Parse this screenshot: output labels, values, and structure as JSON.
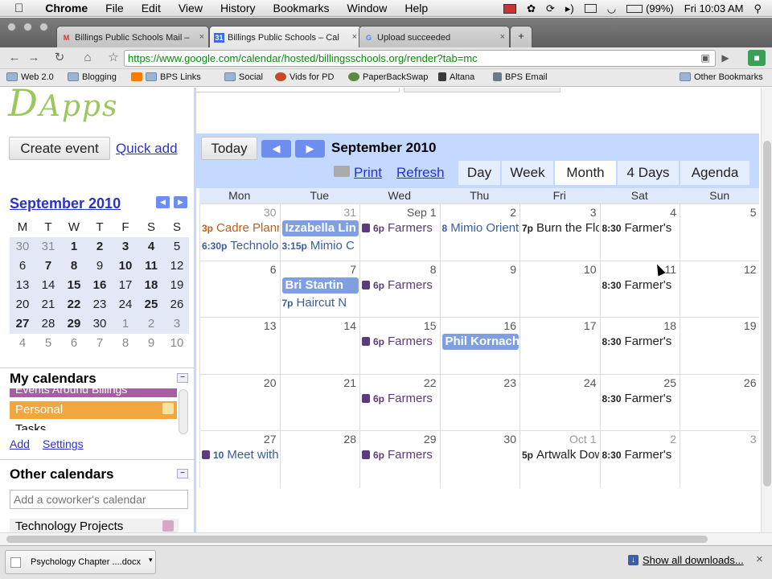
{
  "menubar": {
    "app_name": "Chrome",
    "menus": [
      "File",
      "Edit",
      "View",
      "History",
      "Bookmarks",
      "Window",
      "Help"
    ],
    "battery": "(99%)",
    "clock": "Fri 10:03 AM"
  },
  "tabs": [
    {
      "title": "Billings Public Schools Mail –",
      "icon": "gmail-icon",
      "color": "#d93025"
    },
    {
      "title": "Billings Public Schools – Cal",
      "icon": "calendar-31-icon",
      "color": "#3b6fd6",
      "fav_text": "31"
    },
    {
      "title": "Upload succeeded",
      "icon": "google-g-icon",
      "color": "#4a8af4"
    }
  ],
  "omnibox": {
    "url": "https://www.google.com/calendar/hosted/billingsschools.org/render?tab=mc"
  },
  "bookmarks": [
    {
      "label": "Web 2.0",
      "icon": "folder-icon"
    },
    {
      "label": "Blogging",
      "icon": "folder-icon"
    },
    {
      "label": "BPS Links",
      "icon": "blogger-icon"
    },
    {
      "label": "Social",
      "icon": "folder-icon"
    },
    {
      "label": "Vids for PD",
      "icon": "vids-icon"
    },
    {
      "label": "PaperBackSwap",
      "icon": "swap-icon"
    },
    {
      "label": "Altana",
      "icon": "altana-icon"
    },
    {
      "label": "BPS Email",
      "icon": "email-icon"
    },
    {
      "label": "Other Bookmarks",
      "icon": "folder-icon"
    }
  ],
  "sidebar": {
    "create_event": "Create event",
    "quick_add": "Quick add",
    "mini_title": "September 2010",
    "weekdays": [
      "M",
      "T",
      "W",
      "T",
      "F",
      "S",
      "S"
    ],
    "weeks": [
      [
        "30",
        "31",
        "1",
        "2",
        "3",
        "4",
        "5"
      ],
      [
        "6",
        "7",
        "8",
        "9",
        "10",
        "11",
        "12"
      ],
      [
        "13",
        "14",
        "15",
        "16",
        "17",
        "18",
        "19"
      ],
      [
        "20",
        "21",
        "22",
        "23",
        "24",
        "25",
        "26"
      ],
      [
        "27",
        "28",
        "29",
        "30",
        "1",
        "2",
        "3"
      ],
      [
        "4",
        "5",
        "6",
        "7",
        "8",
        "9",
        "10"
      ]
    ],
    "my_calendars_title": "My calendars",
    "my_calendars": [
      {
        "label": "Events Around Billings",
        "color": "#a65fa3"
      },
      {
        "label": "Personal",
        "color": "#f2a640"
      },
      {
        "label": "Tasks",
        "color": "#ffffff"
      }
    ],
    "add_link": "Add",
    "settings_link": "Settings",
    "other_calendars_title": "Other calendars",
    "coworker_placeholder": "Add a coworker's calendar",
    "other_calendars": [
      {
        "label": "Technology Projects",
        "color": "#f0f0f0"
      }
    ]
  },
  "main": {
    "today_btn": "Today",
    "month_title": "September 2010",
    "print_link": "Print",
    "refresh_link": "Refresh",
    "views": [
      "Day",
      "Week",
      "Month",
      "4 Days",
      "Agenda"
    ],
    "selected_view": "Month",
    "weekday_headers": [
      "Mon",
      "Tue",
      "Wed",
      "Thu",
      "Fri",
      "Sat",
      "Sun"
    ],
    "weeks": [
      [
        "30",
        "31",
        "Sep 1",
        "2",
        "3",
        "4",
        "5"
      ],
      [
        "6",
        "7",
        "8",
        "9",
        "10",
        "11",
        "12"
      ],
      [
        "13",
        "14",
        "15",
        "16",
        "17",
        "18",
        "19"
      ],
      [
        "20",
        "21",
        "22",
        "23",
        "24",
        "25",
        "26"
      ],
      [
        "27",
        "28",
        "29",
        "30",
        "Oct 1",
        "2",
        "3"
      ]
    ]
  },
  "events": [
    {
      "week": 0,
      "day": 0,
      "row": 0,
      "time": "3p",
      "title": "Cadre Planning",
      "color": "#c25d1a"
    },
    {
      "week": 0,
      "day": 0,
      "row": 1,
      "time": "6:30p",
      "title": "Technology",
      "color": "#3a5d9c"
    },
    {
      "week": 0,
      "day": 1,
      "row": 0,
      "chip": true,
      "title": "Izzabella Lin",
      "color": "#7f9fe0"
    },
    {
      "week": 0,
      "day": 1,
      "row": 1,
      "time": "3:15p",
      "title": "Mimio C",
      "color": "#3a5d9c"
    },
    {
      "week": 0,
      "day": 2,
      "row": 0,
      "recur": true,
      "time": "6p",
      "title": "Farmers",
      "color": "#5c3a7c"
    },
    {
      "week": 0,
      "day": 3,
      "row": 0,
      "time": "8",
      "title": "Mimio Orientation",
      "color": "#3a5d9c"
    },
    {
      "week": 0,
      "day": 4,
      "row": 0,
      "time": "7p",
      "title": "Burn the Floor",
      "color": "#222222"
    },
    {
      "week": 0,
      "day": 5,
      "row": 0,
      "time": "8:30",
      "title": "Farmer's",
      "color": "#222222"
    },
    {
      "week": 1,
      "day": 1,
      "row": 0,
      "chip": true,
      "title": "Bri Startin",
      "color": "#7f9fe0"
    },
    {
      "week": 1,
      "day": 1,
      "row": 1,
      "time": "7p",
      "title": "Haircut N",
      "color": "#3a5d9c"
    },
    {
      "week": 1,
      "day": 2,
      "row": 0,
      "recur": true,
      "time": "6p",
      "title": "Farmers",
      "color": "#5c3a7c"
    },
    {
      "week": 1,
      "day": 5,
      "row": 0,
      "time": "8:30",
      "title": "Farmer's",
      "color": "#222222"
    },
    {
      "week": 2,
      "day": 2,
      "row": 0,
      "recur": true,
      "time": "6p",
      "title": "Farmers",
      "color": "#5c3a7c"
    },
    {
      "week": 2,
      "day": 3,
      "row": 0,
      "chip": true,
      "title": "Phil Kornach",
      "color": "#7f9fe0"
    },
    {
      "week": 2,
      "day": 5,
      "row": 0,
      "time": "8:30",
      "title": "Farmer's",
      "color": "#222222"
    },
    {
      "week": 3,
      "day": 2,
      "row": 0,
      "recur": true,
      "time": "6p",
      "title": "Farmers",
      "color": "#5c3a7c"
    },
    {
      "week": 3,
      "day": 5,
      "row": 0,
      "time": "8:30",
      "title": "Farmer's",
      "color": "#222222"
    },
    {
      "week": 4,
      "day": 0,
      "row": 0,
      "recur": true,
      "time": "10",
      "title": "Meet with",
      "color": "#3a5d9c"
    },
    {
      "week": 4,
      "day": 2,
      "row": 0,
      "recur": true,
      "time": "6p",
      "title": "Farmers",
      "color": "#5c3a7c"
    },
    {
      "week": 4,
      "day": 4,
      "row": 0,
      "time": "5p",
      "title": "Artwalk Downtown",
      "color": "#222222"
    },
    {
      "week": 4,
      "day": 5,
      "row": 0,
      "time": "8:30",
      "title": "Farmer's",
      "color": "#222222"
    }
  ],
  "statusbar": {
    "download_name": "Psychology Chapter ....docx",
    "show_all": "Show all downloads..."
  }
}
